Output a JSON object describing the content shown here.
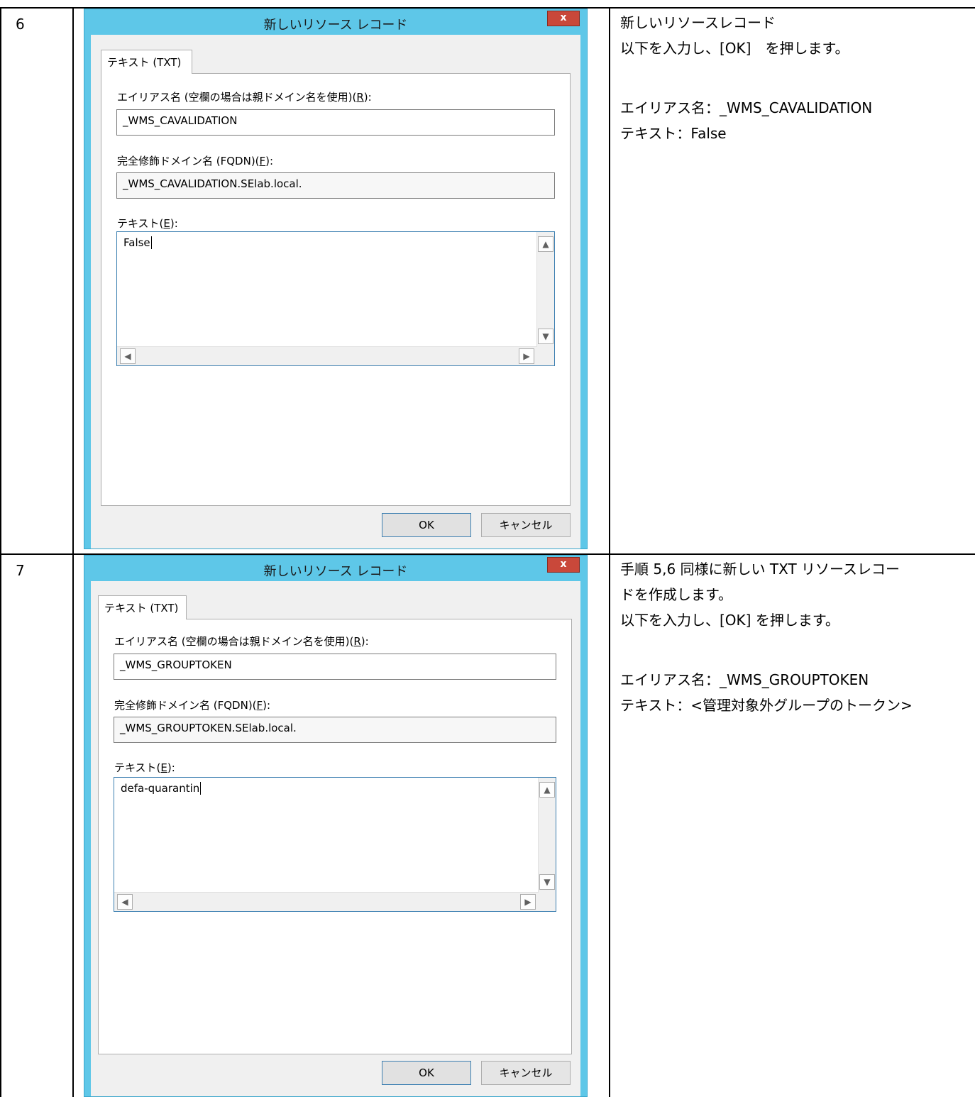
{
  "steps": [
    {
      "number": "6",
      "dialog": {
        "title": "新しいリソース レコード",
        "close_label": "x",
        "tab_label": "テキスト (TXT)",
        "alias_label_prefix": "エイリアス名 (空欄の場合は親ドメイン名を使用)(",
        "alias_label_key": "R",
        "alias_label_suffix": "):",
        "alias_value": "_WMS_CAVALIDATION",
        "fqdn_label_prefix": "完全修飾ドメイン名 (FQDN)(",
        "fqdn_label_key": "F",
        "fqdn_label_suffix": "):",
        "fqdn_value": "_WMS_CAVALIDATION.SElab.local.",
        "text_label_prefix": "テキスト(",
        "text_label_key": "E",
        "text_label_suffix": "):",
        "text_value": "False",
        "ok_label": "OK",
        "cancel_label": "キャンセル"
      },
      "description": [
        "新しいリソースレコード",
        "以下を入力し、[OK]　を押します。",
        "",
        "エイリアス名：_WMS_CAVALIDATION",
        "テキスト：False"
      ]
    },
    {
      "number": "7",
      "dialog": {
        "title": "新しいリソース レコード",
        "close_label": "x",
        "tab_label": "テキスト (TXT)",
        "alias_label_prefix": "エイリアス名 (空欄の場合は親ドメイン名を使用)(",
        "alias_label_key": "R",
        "alias_label_suffix": "):",
        "alias_value": "_WMS_GROUPTOKEN",
        "fqdn_label_prefix": "完全修飾ドメイン名 (FQDN)(",
        "fqdn_label_key": "F",
        "fqdn_label_suffix": "):",
        "fqdn_value": "_WMS_GROUPTOKEN.SElab.local.",
        "text_label_prefix": "テキスト(",
        "text_label_key": "E",
        "text_label_suffix": "):",
        "text_value": "defa-quarantin",
        "ok_label": "OK",
        "cancel_label": "キャンセル"
      },
      "description": [
        "手順 5,6 同様に新しい TXT リソースレコー",
        "ドを作成します。",
        "以下を入力し、[OK] を押します。",
        "",
        "エイリアス名：_WMS_GROUPTOKEN",
        "テキスト：<管理対象外グループのトークン>"
      ]
    }
  ],
  "icons": {
    "scroll_up": "▲",
    "scroll_down": "▼",
    "scroll_left": "◀",
    "scroll_right": "▶"
  },
  "colors": {
    "dialog_frame": "#5ec7e8",
    "close_button": "#c9483a",
    "focus_border": "#3c7fb1"
  }
}
